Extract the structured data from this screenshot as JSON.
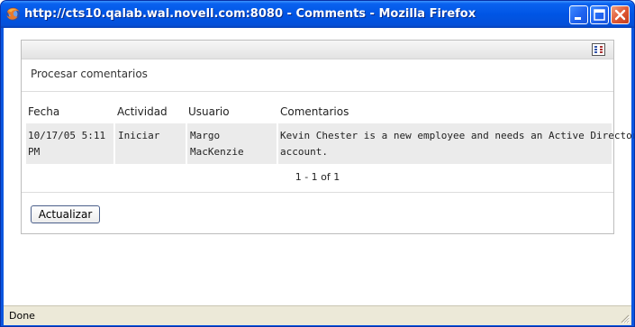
{
  "window": {
    "title": "http://cts10.qalab.wal.novell.com:8080 - Comments - Mozilla Firefox"
  },
  "panel": {
    "section_title": "Procesar comentarios",
    "columns": {
      "date": "Fecha",
      "activity": "Actividad",
      "user": "Usuario",
      "comments": "Comentarios"
    },
    "rows": [
      {
        "date_line1": "10/17/05 5:11",
        "date_line2": "PM",
        "activity": "Iniciar",
        "user_line1": "Margo",
        "user_line2": "MacKenzie",
        "comment_line1": "Kevin Chester is a new employee and needs an Active Directory",
        "comment_line2": "account."
      }
    ],
    "pagination": "1 - 1 of 1",
    "update_button": "Actualizar"
  },
  "statusbar": {
    "text": "Done"
  },
  "icons": {
    "app": "firefox-icon",
    "minimize": "minimize-icon",
    "maximize": "maximize-icon",
    "close": "close-icon",
    "toolbar": "grid-menu-icon",
    "grip": "resize-grip-icon"
  },
  "colors": {
    "titlebar": "#0055e5",
    "close_button": "#e05a36",
    "row_background": "#ebebeb",
    "statusbar": "#ece9d8"
  }
}
